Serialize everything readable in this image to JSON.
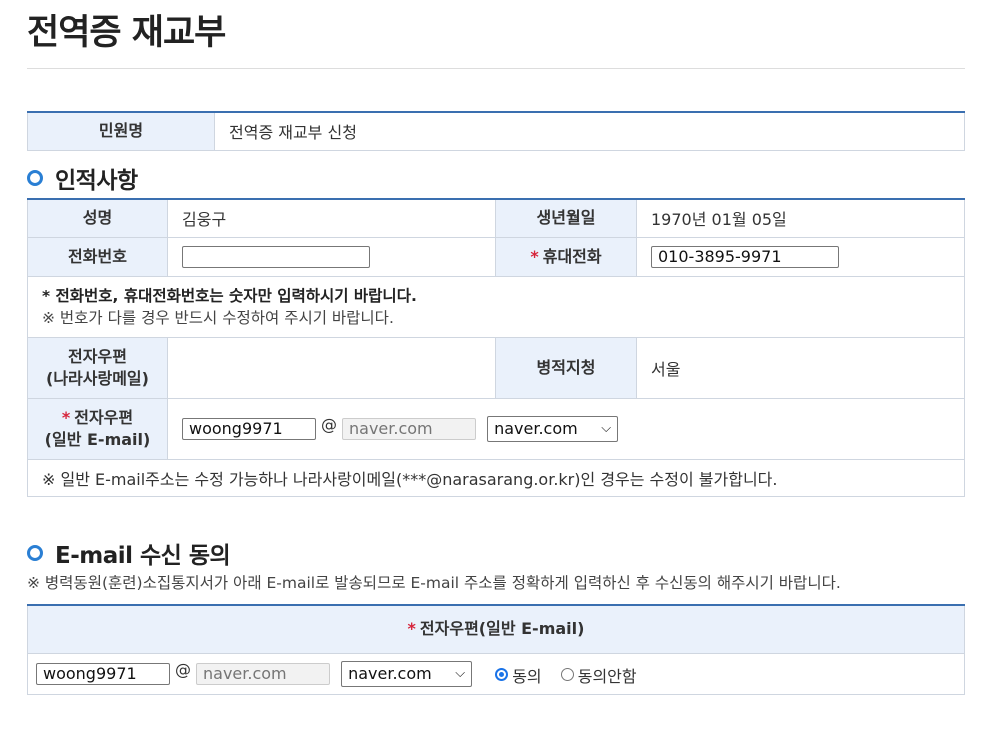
{
  "page": {
    "title": "전역증 재교부"
  },
  "petition": {
    "label": "민원명",
    "value": "전역증 재교부 신청"
  },
  "personal": {
    "section_title": "인적사항",
    "name_label": "성명",
    "name_value": "김웅구",
    "birth_label": "생년월일",
    "birth_value": "1970년 01월 05일",
    "phone_label": "전화번호",
    "phone_value": "",
    "mobile_label": "휴대전화",
    "mobile_value": "010-3895-9971",
    "phone_note_bold": "* 전화번호, 휴대전화번호는 숫자만 입력하시기 바랍니다.",
    "phone_note": "※ 번호가 다를 경우 반드시 수정하여 주시기 바랍니다.",
    "nara_email_label_1": "전자우편",
    "nara_email_label_2": "(나라사랑메일)",
    "nara_email_value": "",
    "office_label": "병적지청",
    "office_value": "서울",
    "email_label_1": "전자우편",
    "email_label_2": "(일반 E-mail)",
    "email_id": "woong9971",
    "email_domain_placeholder": "naver.com",
    "email_domain_select": "naver.com",
    "email_note": "※ 일반 E-mail주소는 수정 가능하나 나라사랑이메일(***@narasarang.or.kr)인 경우는 수정이 불가합니다."
  },
  "consent": {
    "section_title": "E-mail 수신 동의",
    "note": "※ 병력동원(훈련)소집통지서가 아래 E-mail로 발송되므로 E-mail 주소를 정확하게 입력하신 후 수신동의 해주시기 바랍니다.",
    "header": "전자우편(일반 E-mail)",
    "email_id": "woong9971",
    "email_domain_placeholder": "naver.com",
    "email_domain_select": "naver.com",
    "agree_label": "동의",
    "disagree_label": "동의안함",
    "selected": "agree"
  },
  "icons": {
    "section_bullet": "circle-bullet-icon",
    "select_arrow": "chevron-down-icon"
  },
  "colors": {
    "accent": "#3a6fb0",
    "header_bg": "#eaf1fb",
    "required": "#d6243b"
  }
}
